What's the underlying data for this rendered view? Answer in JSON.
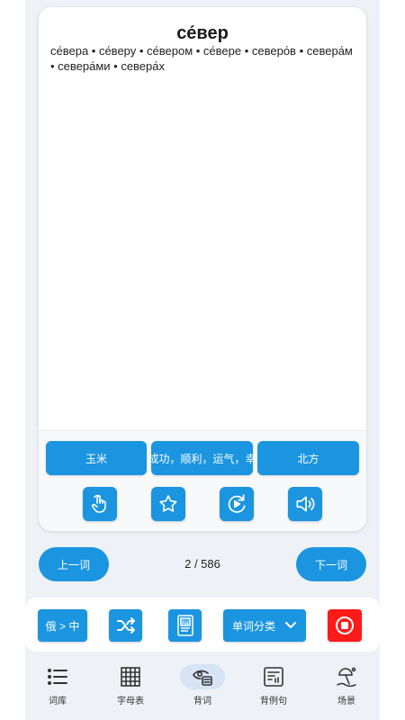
{
  "card": {
    "word": "се́вер",
    "forms": "се́вера • се́веру • се́вером • се́вере • северо́в • севера́м • севера́ми • севера́х",
    "answers": [
      "玉米",
      "成功，顺利，运气，幸",
      "北方"
    ],
    "tools": [
      {
        "icon": "tap-hand-icon"
      },
      {
        "icon": "star-icon"
      },
      {
        "icon": "replay-icon"
      },
      {
        "icon": "speaker-icon"
      }
    ]
  },
  "navigation": {
    "prev_label": "上一词",
    "counter": "2 / 586",
    "next_label": "下一词"
  },
  "controls": {
    "direction_label": "俄 > 中",
    "shuffle_icon": "shuffle-icon",
    "dictionary_icon": "book-icon",
    "category_label": "单词分类",
    "stop_icon": "stop-icon",
    "stop_color": "#ff1a1a"
  },
  "tabbar": {
    "tabs": [
      {
        "label": "词库",
        "icon": "list-icon",
        "active": false
      },
      {
        "label": "字母表",
        "icon": "grid-table-icon",
        "active": false
      },
      {
        "label": "背词",
        "icon": "eye-card-icon",
        "active": true
      },
      {
        "label": "背例句",
        "icon": "sentence-icon",
        "active": false
      },
      {
        "label": "场景",
        "icon": "beach-icon",
        "active": false
      }
    ]
  },
  "colors": {
    "accent": "#1b95e0",
    "background": "#eef1f5",
    "active_tab": "#d6e4f5"
  }
}
